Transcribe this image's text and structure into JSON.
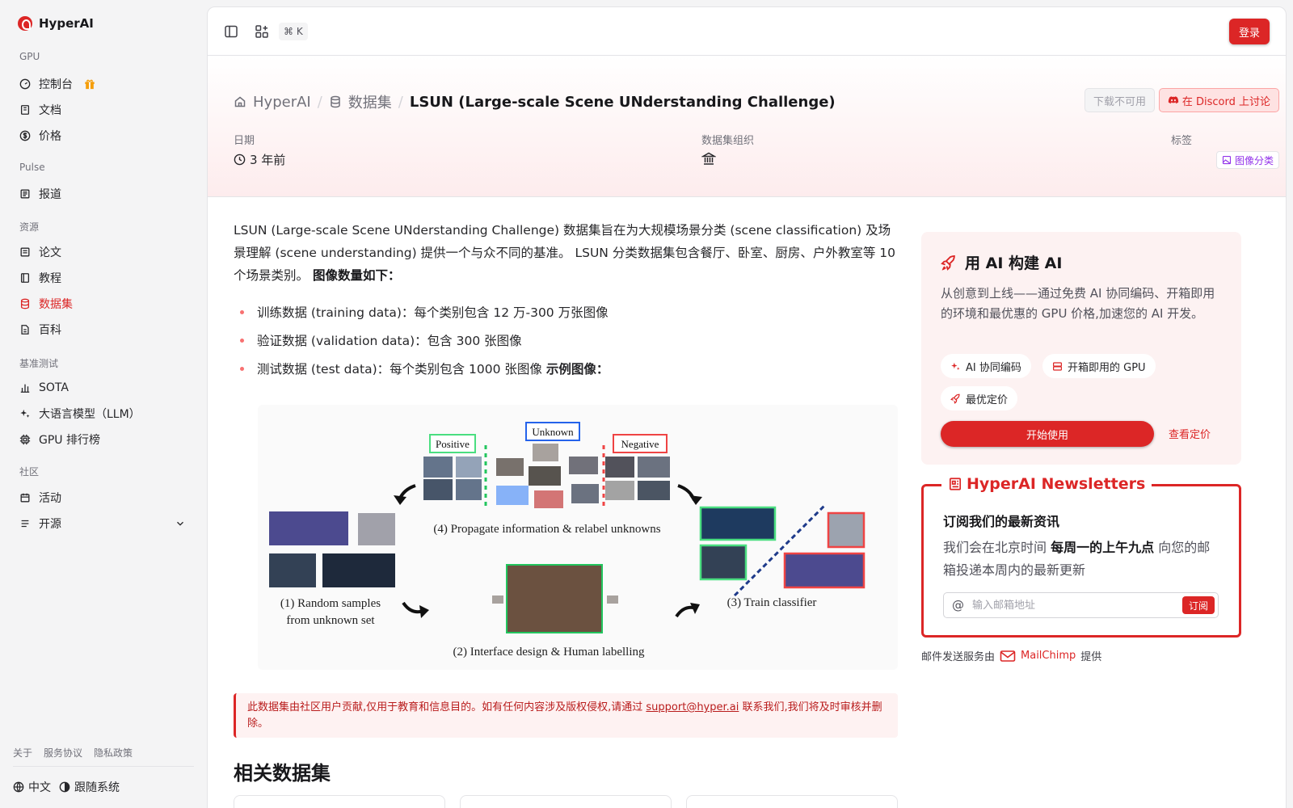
{
  "brand": {
    "name": "HyperAI"
  },
  "sidebar": {
    "sections": {
      "gpu": "GPU",
      "pulse": "Pulse",
      "resources": "资源",
      "benchmark": "基准测试",
      "community": "社区"
    },
    "items": {
      "console": "控制台",
      "docs": "文档",
      "pricing": "价格",
      "reports": "报道",
      "papers": "论文",
      "tutorials": "教程",
      "datasets": "数据集",
      "wiki": "百科",
      "sota": "SOTA",
      "llm": "大语言模型（LLM）",
      "gpu_rank": "GPU 排行榜",
      "events": "活动",
      "opensource": "开源"
    },
    "footer": {
      "about": "关于",
      "terms": "服务协议",
      "privacy": "隐私政策",
      "language": "中文",
      "theme": "跟随系统"
    }
  },
  "topbar": {
    "shortcut": "⌘ K",
    "login": "登录"
  },
  "header": {
    "crumb_home": "HyperAI",
    "crumb_section": "数据集",
    "title": "LSUN (Large-scale Scene UNderstanding Challenge)",
    "download": "下载不可用",
    "discord": "在 Discord 上讨论",
    "date_label": "日期",
    "date_value": "3 年前",
    "org_label": "数据集组织",
    "tag_label": "标签",
    "tag_value": "图像分类"
  },
  "article": {
    "intro": "LSUN (Large-scale Scene UNderstanding Challenge) 数据集旨在为大规模场景分类 (scene classification) 及场景理解 (scene understanding) 提供一个与众不同的基准。 LSUN 分类数据集包含餐厅、卧室、厨房、户外教室等 10 个场景类别。 ",
    "intro_bold": "图像数量如下：",
    "bullets": [
      "训练数据 (training data)：每个类别包含 12 万-300 万张图像",
      "验证数据 (validation data)：包含 300 张图像",
      "测试数据 (test data)：每个类别包含 1000 张图像 "
    ],
    "bullet_bold": "示例图像：",
    "figure": {
      "positive": "Positive",
      "unknown": "Unknown",
      "negative": "Negative",
      "step1": "(1) Random samples",
      "step1b": "from unknown set",
      "step2": "(2) Interface design & Human labelling",
      "step3": "(3) Train classifier",
      "step4": "(4) Propagate information & relabel unknowns"
    },
    "notice": "此数据集由社区用户贡献,仅用于教育和信息目的。如有任何内容涉及版权侵权,请通过 ",
    "notice_email": "support@hyper.ai",
    "notice_tail": " 联系我们,我们将及时审核并删除。",
    "related": "相关数据集"
  },
  "cta": {
    "title": "用 AI 构建 AI",
    "desc": "从创意到上线——通过免费 AI 协同编码、开箱即用的环境和最优惠的 GPU 价格,加速您的 AI 开发。",
    "chip1": "AI 协同编码",
    "chip2": "开箱即用的 GPU",
    "chip3": "最优定价",
    "start": "开始使用",
    "pricing": "查看定价"
  },
  "newsletter": {
    "title": "HyperAI Newsletters",
    "heading": "订阅我们的最新资讯",
    "desc_a": "我们会在北京时间 ",
    "desc_bold": "每周一的上午九点",
    "desc_b": " 向您的邮箱投递本周内的最新更新",
    "placeholder": "输入邮箱地址",
    "subscribe": "订阅",
    "by_a": "邮件发送服务由",
    "by_brand": "MailChimp",
    "by_b": "提供"
  },
  "colors": {
    "accent": "#dc2626",
    "tag": "#9333ea"
  }
}
